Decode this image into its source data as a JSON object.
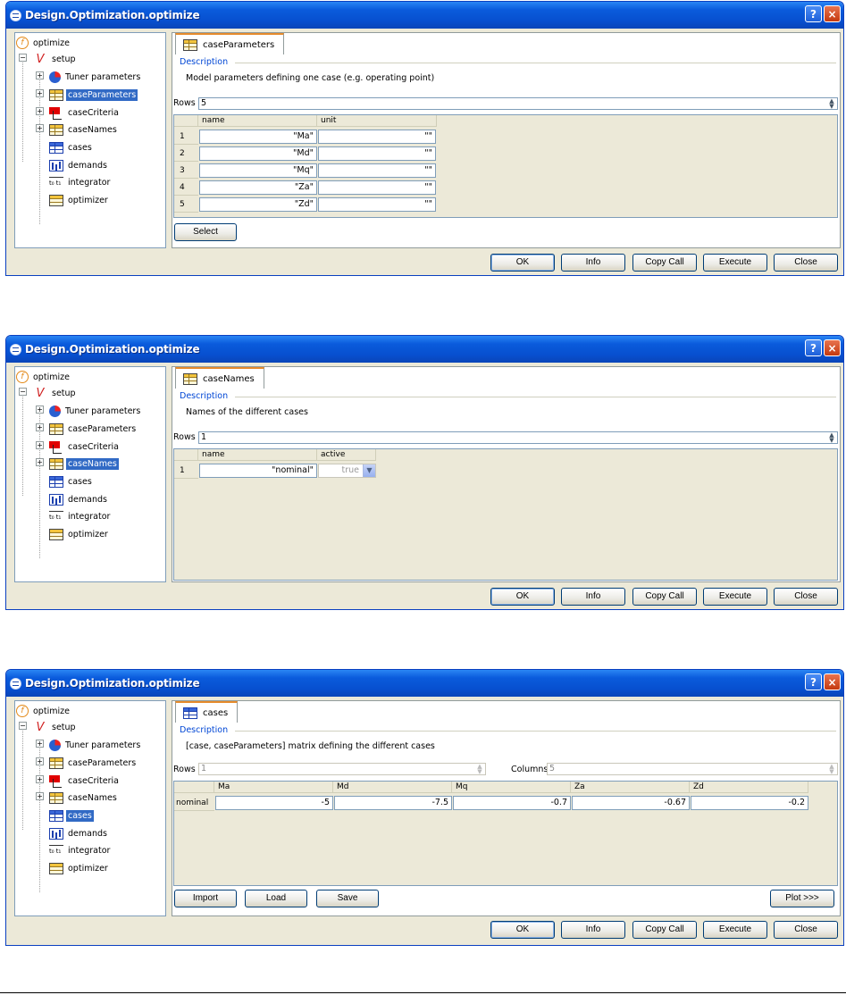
{
  "window_title": "Design.Optimization.optimize",
  "help_glyph": "?",
  "close_glyph": "×",
  "colors": {
    "title_bar": "#0a5bdc",
    "selection": "#316ac5",
    "description_title": "#0046d5",
    "tab_accent": "#e68b2c"
  },
  "tree": {
    "root": "optimize",
    "setup": "setup",
    "items": [
      "Tuner parameters",
      "caseParameters",
      "caseCriteria",
      "caseNames",
      "cases",
      "demands",
      "integrator",
      "optimizer"
    ],
    "icons": [
      "pie-chart-icon",
      "table-icon",
      "criteria-icon",
      "table-icon",
      "cases-table-icon",
      "bar-chart-icon",
      "integrator-icon",
      "table-icon"
    ]
  },
  "footer_buttons": {
    "ok": "OK",
    "info": "Info",
    "copy_call": "Copy Call",
    "execute": "Execute",
    "close": "Close"
  },
  "description_title": "Description",
  "rows_label": "Rows",
  "columns_label": "Columns",
  "dialog1": {
    "selected_item": "caseParameters",
    "tab": "caseParameters",
    "description": "Model parameters defining one case (e.g. operating point)",
    "rows": "5",
    "columns": [
      "name",
      "unit"
    ],
    "row_numbers": [
      "1",
      "2",
      "3",
      "4",
      "5"
    ],
    "cells": [
      [
        "\"Ma\"",
        "\"\""
      ],
      [
        "\"Md\"",
        "\"\""
      ],
      [
        "\"Mq\"",
        "\"\""
      ],
      [
        "\"Za\"",
        "\"\""
      ],
      [
        "\"Zd\"",
        "\"\""
      ]
    ],
    "select_button": "Select"
  },
  "dialog2": {
    "selected_item": "caseNames",
    "tab": "caseNames",
    "description": "Names of the different cases",
    "rows": "1",
    "columns": [
      "name",
      "active"
    ],
    "row_numbers": [
      "1"
    ],
    "name_value": "\"nominal\"",
    "active_value": "true"
  },
  "dialog3": {
    "selected_item": "cases",
    "tab": "cases",
    "description": "[case, caseParameters] matrix defining the different cases",
    "rows": "1",
    "columns_count": "5",
    "columns": [
      "Ma",
      "Md",
      "Mq",
      "Za",
      "Zd"
    ],
    "row_names": [
      "nominal"
    ],
    "values": [
      "-5",
      "-7.5",
      "-0.7",
      "-0.67",
      "-0.2"
    ],
    "buttons": {
      "import": "Import",
      "load": "Load",
      "save": "Save",
      "plot": "Plot >>>"
    }
  }
}
